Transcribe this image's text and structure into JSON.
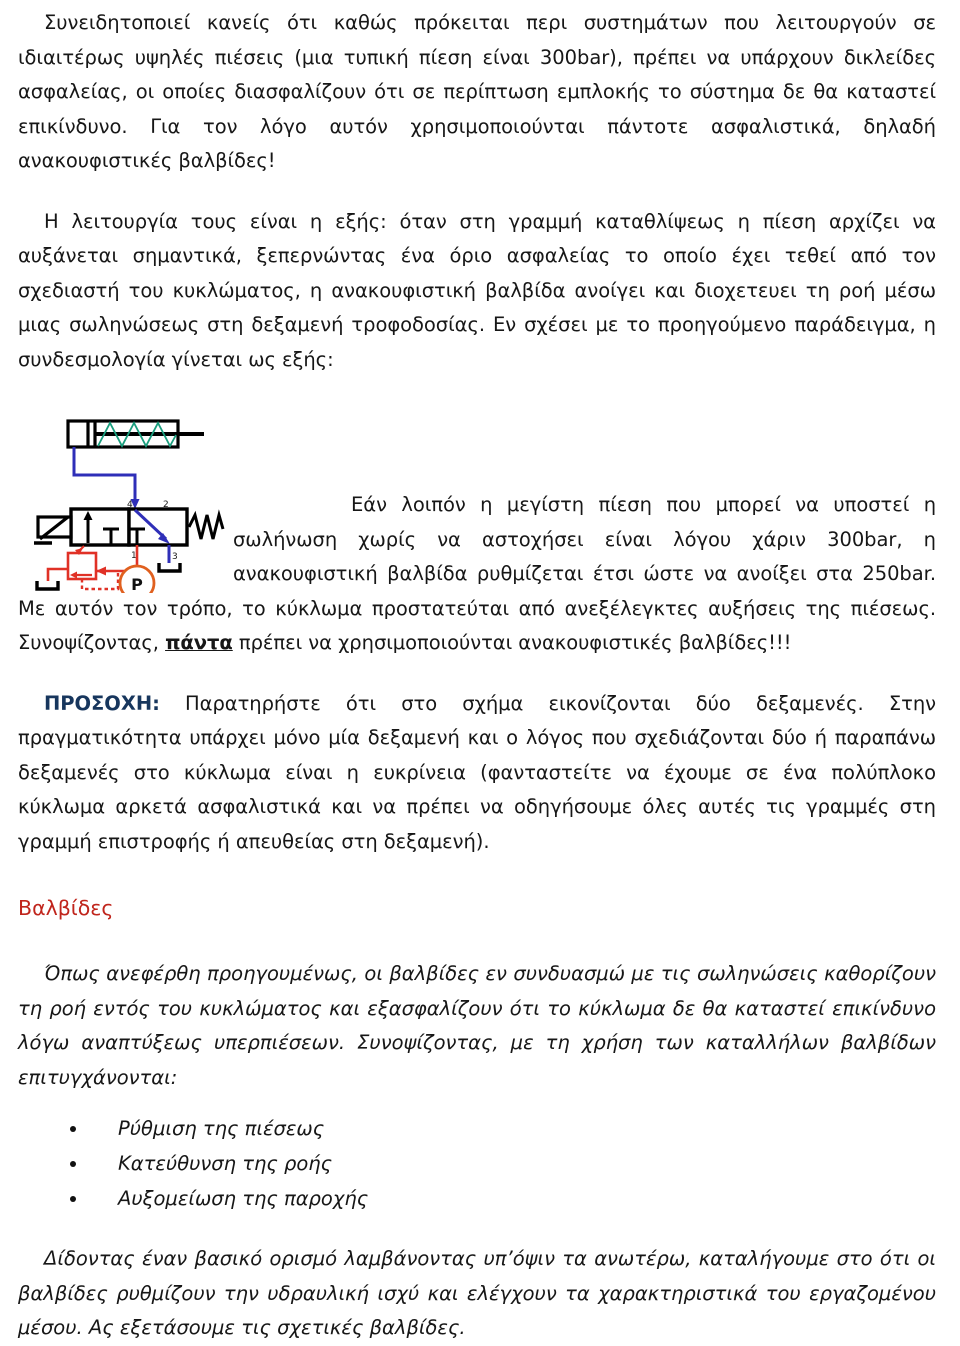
{
  "document": {
    "language": "el",
    "paragraphs": {
      "intro": "Συνειδητοποιεί κανείς ότι καθώς πρόκειται περι συστημάτων που λειτουργούν σε ιδιαιτέρως υψηλές πιέσεις (μια τυπική πίεση είναι 300bar), πρέπει να υπάρχουν δικλείδες ασφαλείας, οι οποίες διασφαλίζουν ότι σε περίπτωση εμπλοκής το σύστημα δε θα καταστεί επικίνδυνο. Για τον λόγο αυτόν χρησιμοποιούνται πάντοτε ασφαλιστικά, δηλαδή ανακουφιστικές βαλβίδες!",
      "operation": "Η λειτουργία τους είναι η εξής: όταν στη γραμμή καταθλίψεως η πίεση αρχίζει να αυξάνεται σημαντικά, ξεπερνώντας ένα όριο ασφαλείας το οποίο έχει τεθεί από τον σχεδιαστή του κυκλώματος, η ανακουφιστική βαλβίδα ανοίγει και διοχετευει τη ροή μέσω μιας σωληνώσεως στη δεξαμενή τροφοδοσίας. Εν σχέσει με το προηγούμενο παράδειγμα, η συνδεσμολογία γίνεται ως εξής:",
      "after_figure_part1": "Εάν λοιπόν η μεγίστη πίεση που μπορεί να υποστεί η σωλήνωση χωρίς να αστοχήσει είναι λόγου χάριν 300bar, η ανακουφιστική βαλβίδα ρυθμίζεται έτσι ώστε να ανοίξει στα 250bar. Με αυτόν τον τρόπο, το κύκλωμα προστατεύται από ανεξέλεγκτες αυξήσεις της πιέσεως. Συνοψίζοντας, ",
      "after_figure_emphasis": "πάντα",
      "after_figure_part2": " πρέπει να χρησιμοποιούνται ανακουφιστικές βαλβίδες!!!",
      "attention_label": "ΠΡΟΣΟΧΗ:",
      "attention_body": " Παρατηρήστε ότι στο σχήμα εικονίζονται δύο δεξαμενές. Στην πραγματικότητα υπάρχει μόνο μία δεξαμενή και ο λόγος που σχεδιάζονται δύο ή παραπάνω δεξαμενές στο κύκλωμα είναι η ευκρίνεια (φανταστείτε να έχουμε σε ένα πολύπλοκο κύκλωμα αρκετά ασφαλιστικά και να πρέπει να οδηγήσουμε όλες αυτές τις γραμμές στη γραμμή επιστροφής ή απευθείας στη δεξαμενή).",
      "valves_intro": "Όπως ανεφέρθη προηγουμένως, οι βαλβίδες εν συνδυασμώ με τις σωληνώσεις καθορίζουν τη ροή εντός του κυκλώματος και εξασφαλίζουν ότι το κύκλωμα δε θα καταστεί επικίνδυνο λόγω αναπτύξεως υπερπιέσεων. Συνοψίζοντας, με τη χρήση των καταλλήλων βαλβίδων επιτυγχάνονται:",
      "closing": "Δίδοντας έναν βασικό ορισμό λαμβάνοντας υπ’όψιν τα ανωτέρω, καταλήγουμε στο ότι οι βαλβίδες ρυθμίζουν την υδραυλική ισχύ και ελέγχουν τα χαρακτηριστικά του εργαζομένου μέσου. Ας εξετάσουμε τις σχετικές βαλβίδες."
    },
    "heading": {
      "valves": "Βαλβίδες"
    },
    "bullets": [
      "Ρύθμιση της πιέσεως",
      "Κατεύθυνση της ροής",
      "Αυξομείωση της παροχής"
    ],
    "figure": {
      "caption": "",
      "port_labels": [
        "4",
        "2",
        "1",
        "3"
      ],
      "pump_label": "P",
      "colors": {
        "cylinder_outline": "#000000",
        "spring": "#1a9e7e",
        "work_line": "#2a2ac0",
        "pressure_line": "#e03126",
        "pump_symbol": "#e0601f",
        "valve_body": "#000000"
      }
    }
  },
  "style_colors": {
    "heading_red": "#c0251c",
    "attention_navy": "#17365d",
    "body_text": "#171717"
  }
}
